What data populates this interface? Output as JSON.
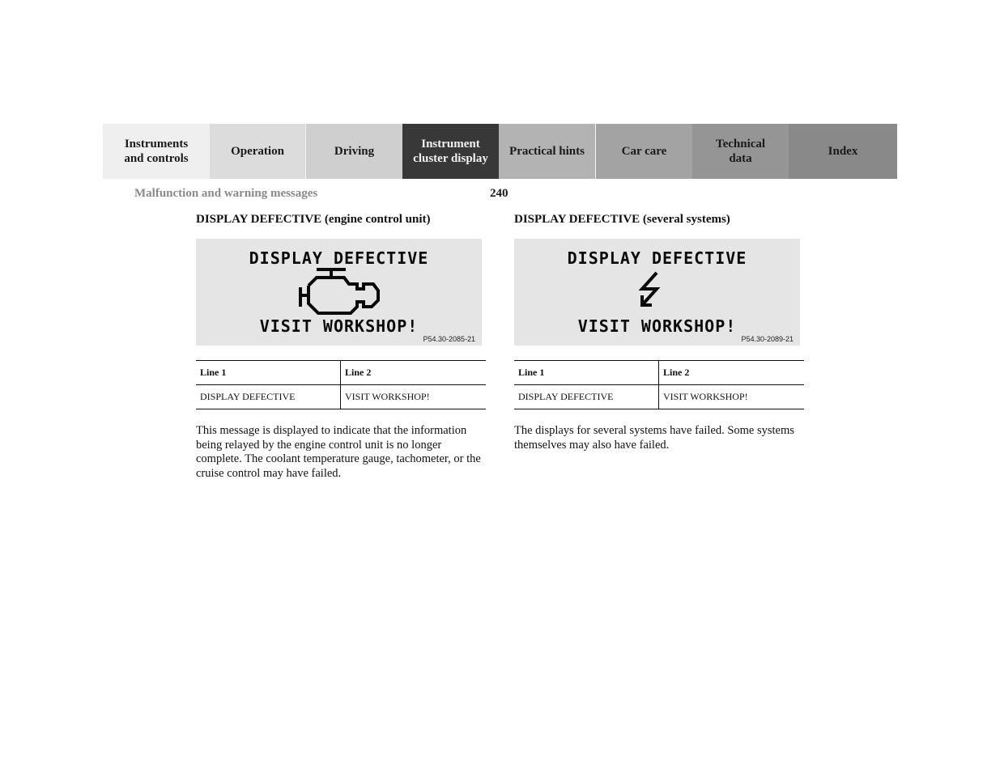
{
  "nav": {
    "tabs": [
      {
        "label": "Instruments\nand controls",
        "active": false
      },
      {
        "label": "Operation",
        "active": false
      },
      {
        "label": "Driving",
        "active": false
      },
      {
        "label": "Instrument\ncluster display",
        "active": true
      },
      {
        "label": "Practical hints",
        "active": false
      },
      {
        "label": "Car care",
        "active": false
      },
      {
        "label": "Technical\ndata",
        "active": false
      },
      {
        "label": "Index",
        "active": false
      }
    ]
  },
  "header": {
    "section_title": "Malfunction and warning messages",
    "page_number": "240"
  },
  "messages": [
    {
      "heading": "DISPLAY DEFECTIVE (engine control unit)",
      "display": {
        "line1": "DISPLAY DEFECTIVE",
        "line2": "VISIT WORKSHOP!",
        "icon": "engine-icon",
        "figure_code": "P54.30-2085-21"
      },
      "table": {
        "headers": [
          "Line 1",
          "Line 2"
        ],
        "rows": [
          [
            "DISPLAY DEFECTIVE",
            "VISIT WORKSHOP!"
          ]
        ]
      },
      "description": "This message is displayed to indicate that the information being relayed by the engine control unit is no longer complete. The coolant temperature gauge, tachometer, or the cruise control may have failed."
    },
    {
      "heading": "DISPLAY DEFECTIVE (several systems)",
      "display": {
        "line1": "DISPLAY DEFECTIVE",
        "line2": "VISIT WORKSHOP!",
        "icon": "lightning-arrow-icon",
        "figure_code": "P54.30-2089-21"
      },
      "table": {
        "headers": [
          "Line 1",
          "Line 2"
        ],
        "rows": [
          [
            "DISPLAY DEFECTIVE",
            "VISIT WORKSHOP!"
          ]
        ]
      },
      "description": "The displays for several systems have failed. Some systems themselves may also have failed."
    }
  ]
}
